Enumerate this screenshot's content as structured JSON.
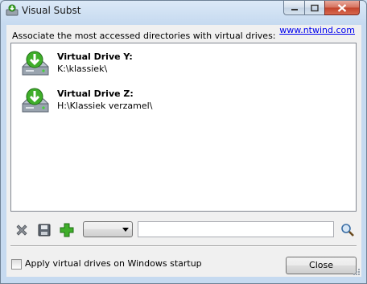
{
  "window": {
    "title": "Visual Subst",
    "controls": [
      "minimize",
      "maximize",
      "close"
    ]
  },
  "header": {
    "label": "Associate the most accessed directories with virtual drives:",
    "link": "www.ntwind.com"
  },
  "drives": [
    {
      "title": "Virtual Drive Y:",
      "path": "K:\\klassiek\\"
    },
    {
      "title": "Virtual Drive Z:",
      "path": "H:\\Klassiek verzamel\\"
    }
  ],
  "toolbar": {
    "drive_select_value": "",
    "path_value": "",
    "icons": [
      "delete-icon",
      "save-icon",
      "add-icon",
      "browse-icon"
    ]
  },
  "footer": {
    "startup_label": "Apply virtual drives on Windows startup",
    "startup_checked": false,
    "close_label": "Close"
  },
  "colors": {
    "link": "#0000ee",
    "drive_icon_green": "#3fae2a",
    "close_button_red": "#c2432b"
  }
}
